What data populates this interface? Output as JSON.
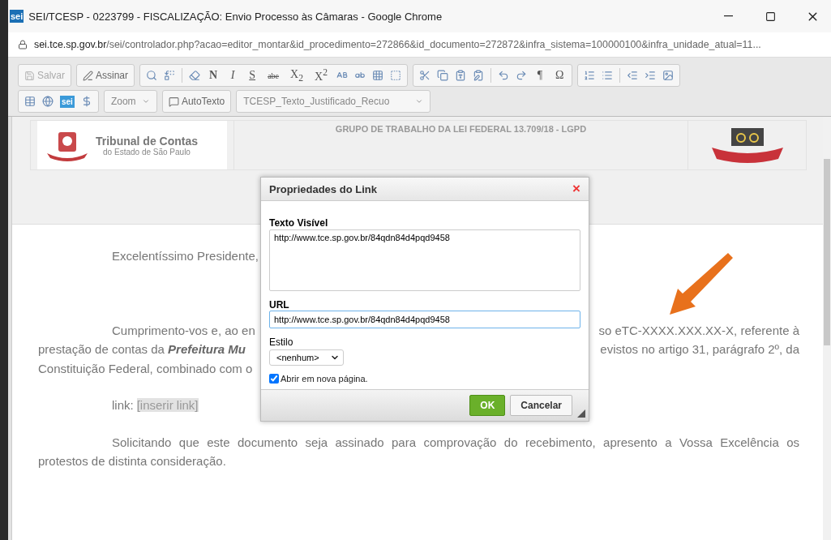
{
  "window": {
    "app_icon_text": "sei",
    "title": "SEI/TCESP - 0223799 - FISCALIZAÇÃO: Envio Processo às Câmaras - Google Chrome"
  },
  "address_bar": {
    "host": "sei.tce.sp.gov.br",
    "path": "/sei/controlador.php?acao=editor_montar&id_procedimento=272866&id_documento=272872&infra_sistema=100000100&infra_unidade_atual=11..."
  },
  "main_toolbar": {
    "groups": [
      {
        "items": [
          {
            "kind": "text",
            "label": "Salvar",
            "disabled": true
          }
        ]
      },
      {
        "items": [
          {
            "kind": "text",
            "label": "Assinar",
            "disabled": false
          }
        ]
      },
      {
        "items": [
          {
            "kind": "icon"
          },
          {
            "kind": "icon"
          },
          {
            "kind": "sep"
          },
          {
            "kind": "icon"
          },
          {
            "kind": "glyph",
            "label": "N"
          },
          {
            "kind": "glyph",
            "label": "I"
          },
          {
            "kind": "glyph",
            "label": "S"
          },
          {
            "kind": "glyph",
            "label": "abe"
          },
          {
            "kind": "glyph",
            "label": "X$_{2}$"
          },
          {
            "kind": "glyph",
            "label": "X$^{2}$"
          },
          {
            "kind": "icon"
          },
          {
            "kind": "icon"
          },
          {
            "kind": "icon"
          },
          {
            "kind": "icon"
          }
        ]
      },
      {
        "items": [
          {
            "kind": "icon"
          },
          {
            "kind": "icon"
          },
          {
            "kind": "icon"
          },
          {
            "kind": "icon"
          },
          {
            "kind": "sep"
          },
          {
            "kind": "icon"
          },
          {
            "kind": "icon"
          },
          {
            "kind": "glyph",
            "label": "¶"
          },
          {
            "kind": "glyph",
            "label": "Ω"
          }
        ]
      },
      {
        "items": [
          {
            "kind": "icon"
          },
          {
            "kind": "icon"
          },
          {
            "kind": "sep"
          },
          {
            "kind": "icon"
          },
          {
            "kind": "icon"
          },
          {
            "kind": "icon"
          }
        ]
      }
    ]
  },
  "secondary_toolbar": {
    "groups": [
      {
        "items": [
          {
            "kind": "icon"
          },
          {
            "kind": "icon"
          },
          {
            "kind": "logo",
            "label": "sei"
          },
          {
            "kind": "icon"
          }
        ]
      },
      {
        "items": [
          {
            "kind": "select",
            "label": "Zoom"
          }
        ]
      },
      {
        "items": [
          {
            "kind": "text",
            "label": "AutoTexto",
            "disabled": false
          }
        ]
      },
      {
        "items": [
          {
            "kind": "select",
            "label": "TCESP_Texto_Justificado_Recuo"
          }
        ]
      }
    ]
  },
  "document": {
    "header": {
      "logo_title": "Tribunal de Contas",
      "logo_subtitle": "do Estado de São Paulo",
      "title": "GRUPO DE TRABALHO DA LEI FEDERAL 13.709/18 - LGPD"
    },
    "paragraphs": [
      {
        "lines": [
          {
            "left": "Excelentíssimo Presidente,"
          }
        ]
      },
      {
        "lines": [
          {
            "left": "Cumprimento-vos e, ao en",
            "right": "so eTC-XXXX.XXX.XX-X, referente à"
          },
          {
            "left": "prestação de contas da **Prefeitura Mu**",
            "right": "evistos no artigo 31, parágrafo 2º, da"
          },
          {
            "left": "Constituição Federal, combinado com o"
          }
        ]
      },
      {
        "lines": [
          {
            "left": "link:",
            "placeholder": "[inserir link]"
          }
        ]
      },
      {
        "lines": [
          {
            "left": "Solicitando que este documento seja assinado para comprovação do recebimento, apresento a Vossa Excelência os"
          },
          {
            "left": "protestos de distinta consideração."
          }
        ]
      }
    ]
  },
  "dialog": {
    "title": "Propriedades do Link",
    "close": "×",
    "visible_text": {
      "label": "Texto Visível",
      "value": "http://www.tce.sp.gov.br/84qdn84d4pqd9458"
    },
    "url": {
      "label": "URL",
      "value": "http://www.tce.sp.gov.br/84qdn84d4pqd9458",
      "focused": true
    },
    "style": {
      "label": "Estilo",
      "value": "<nenhum>"
    },
    "new_page": {
      "label": "Abrir em nova página.",
      "checked": true
    },
    "buttons": [
      {
        "label": "OK",
        "kind": "primary"
      },
      {
        "label": "Cancelar",
        "kind": "secondary"
      }
    ]
  }
}
